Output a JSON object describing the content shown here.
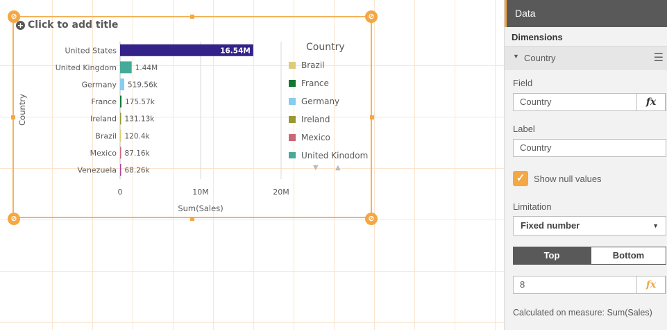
{
  "sheet": {
    "add_title": "Click to add title"
  },
  "chart_data": {
    "type": "bar",
    "orientation": "horizontal",
    "title": "",
    "xlabel": "Sum(Sales)",
    "ylabel": "Country",
    "xlim": [
      0,
      20000000
    ],
    "xticks": [
      0,
      10000000,
      20000000
    ],
    "xtick_labels": [
      "0",
      "10M",
      "20M"
    ],
    "categories": [
      "United States",
      "United Kingdom",
      "Germany",
      "France",
      "Ireland",
      "Brazil",
      "Mexico",
      "Venezuela"
    ],
    "values": [
      16540000,
      1440000,
      519560,
      175570,
      131130,
      120400,
      87160,
      68260
    ],
    "value_labels": [
      "16.54M",
      "1.44M",
      "519.56k",
      "175.57k",
      "131.13k",
      "120.4k",
      "87.16k",
      "68.26k"
    ],
    "colors": [
      "#332288",
      "#44aa99",
      "#88ccee",
      "#117733",
      "#999933",
      "#ddcc77",
      "#cc6677",
      "#aa4499"
    ],
    "legend": {
      "title": "Country",
      "position": "right",
      "items": [
        {
          "label": "Brazil",
          "color": "#ddcc77"
        },
        {
          "label": "France",
          "color": "#117733"
        },
        {
          "label": "Germany",
          "color": "#88ccee"
        },
        {
          "label": "Ireland",
          "color": "#999933"
        },
        {
          "label": "Mexico",
          "color": "#cc6677"
        },
        {
          "label": "United Kingdom",
          "color": "#44aa99"
        }
      ]
    },
    "grid": true
  },
  "panel": {
    "header": "Data",
    "section_title": "Dimensions",
    "dimension_name": "Country",
    "field_label": "Field",
    "field_value": "Country",
    "fx_label": "fx",
    "label_label": "Label",
    "label_value": "Country",
    "show_null_label": "Show null values",
    "show_null_checked": true,
    "limitation_label": "Limitation",
    "limitation_value": "Fixed number",
    "segment_top": "Top",
    "segment_bottom": "Bottom",
    "limit_value": "8",
    "calculated_on": "Calculated on measure: Sum(Sales)",
    "accent_color": "#f4a742"
  },
  "icons": {
    "caret": "caret-down-icon",
    "menu": "hamburger-icon",
    "check": "checkmark-icon",
    "plus": "plus-circle-icon"
  }
}
